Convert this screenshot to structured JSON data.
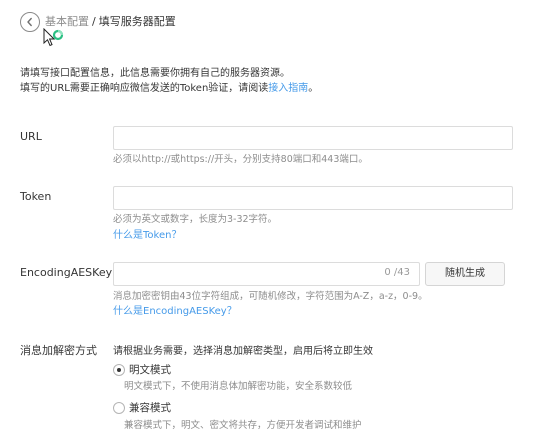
{
  "header": {
    "back_icon": "chevron-left-circle-icon",
    "breadcrumb_parent": "基本配置",
    "breadcrumb_sep": "/",
    "breadcrumb_current": "填写服务器配置",
    "cursor_icon": "busy-pointer-cursor-icon"
  },
  "intro": {
    "line1": "请填写接口配置信息，此信息需要你拥有自己的服务器资源。",
    "line2_prefix": "填写的URL需要正确响应微信发送的Token验证，请阅读",
    "line2_link": "接入指南",
    "line2_suffix": "。"
  },
  "url": {
    "label": "URL",
    "value": "",
    "tip": "必须以http://或https://开头，分别支持80端口和443端口。"
  },
  "token": {
    "label": "Token",
    "value": "",
    "tip": "必须为英文或数字，长度为3-32字符。",
    "help_link": "什么是Token？"
  },
  "aes": {
    "label": "EncodingAESKey",
    "value": "",
    "counter": "0 /43",
    "generate_button": "随机生成",
    "tip": "消息加密密钥由43位字符组成，可随机修改，字符范围为A-Z，a-z，0-9。",
    "help_link": "什么是EncodingAESKey？"
  },
  "encryption": {
    "label": "消息加解密方式",
    "description": "请根据业务需要，选择消息加解密类型，启用后将立即生效",
    "options": [
      {
        "label": "明文模式",
        "tip": "明文模式下，不使用消息体加解密功能，安全系数较低",
        "selected": true
      },
      {
        "label": "兼容模式",
        "tip": "兼容模式下，明文、密文将共存，方便开发者调试和维护",
        "selected": false
      }
    ]
  },
  "colors": {
    "link": "#459ae9",
    "text": "#353535",
    "muted": "#8d8d8d",
    "border": "#dcdcdc",
    "cursor_ring": "#2bbf83"
  }
}
